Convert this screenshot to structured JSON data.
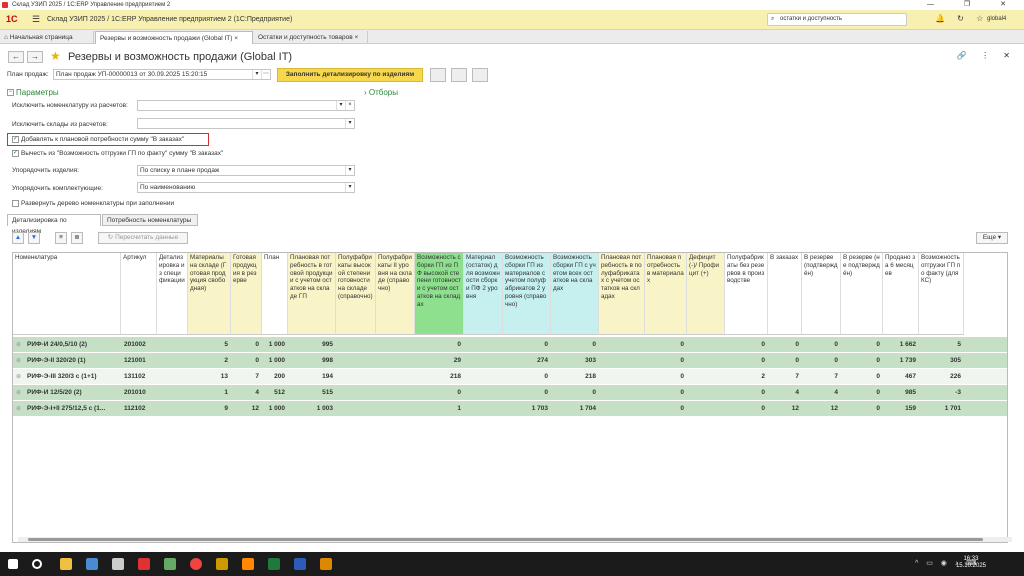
{
  "window": {
    "title": "Склад УЗИП 2025 / 1С:ERP Управление предприятием 2",
    "controls": "— ❐ ✕"
  },
  "app": {
    "logo": "1С",
    "title": "Склад УЗИП 2025 / 1С:ERP Управление предприятием 2  (1С:Предприятие)",
    "search_value": "остатки и доступность",
    "user": "global4",
    "icons": "🔔 ↻ ☆ "
  },
  "tabs": {
    "home": "Начальная страница",
    "tab1": "Резервы и возможность продажи (Global IT)",
    "tab2": "Остатки и доступность товаров",
    "close": "×"
  },
  "form": {
    "title": "Резервы и возможность продажи (Global IT)",
    "back": "←",
    "fwd": "→",
    "star": "★",
    "icons": "🔗 ⋮ ✕"
  },
  "plan": {
    "label": "План продаж:",
    "value": "План продаж УП-00000013 от 30.09.2025 15:20:15",
    "fill_btn": "Заполнить детализировку по изделиям"
  },
  "params": {
    "title": "Параметры",
    "filters": "Отборы",
    "excl_nom_label": "Исключить номенклатуру из расчетов:",
    "excl_wh_label": "Исключить склады из расчетов:",
    "cb1": "Добавлять к плановой потребности сумму \"В заказах\"",
    "cb2": "Вычесть из \"Возможность отгрузки ГП по факту\" сумму \"В заказах\"",
    "order_items_label": "Упорядочить изделия:",
    "order_items_value": "По списку в плане продаж",
    "order_kit_label": "Упорядочить комплектующие:",
    "order_kit_value": "По наименованию",
    "expand_label": "Развернуть дерево номенклатуры при заполнении"
  },
  "subtabs": {
    "t1": "Детализировка по изделиям",
    "t2": "Потребность номенклатуры"
  },
  "toolbar": {
    "recalc": "Пересчитать данные",
    "more": "Еще ▾"
  },
  "columns": [
    "Номенклатура",
    "Артикул",
    "Детализировка из спецификации",
    "Материалы на складе (Готовая продукция свободная)",
    "Готовая продукция в резерве",
    "План",
    "Плановая потребность в готовой продукции с учетом остатков на складе ГП",
    "Полуфабрикаты высокой степени готовности на складе (справочно)",
    "Полуфабрикаты II уровня на складе (справочно)",
    "Возможность сборки ГП из ПФ высокой степени готовности с учетом остатков на складах",
    "Материал (остаток) для возможности сборки ПФ 2 уровня",
    "Возможность сборки ГП из материалов с учетом полуфабрикатов 2 уровня (справочно)",
    "Возможность сборки ГП с учетом всех остатков на складах",
    "Плановая потребность в полуфабрикатах с учетом остатков на складах",
    "Плановая потребность в материалах",
    "Дефицит (-)/ Профицит (+)",
    "Полуфабрикаты без резервов в производстве",
    "В заказах",
    "В резерве (подтверждён)",
    "В резерве (не подтверждён)",
    "Продано за 6 месяцев",
    "Возможность отгрузки ГП по факту (для КС)"
  ],
  "rows": [
    {
      "name": "РИФ-И 24/0,5/10 (2)",
      "art": "201002",
      "d": "",
      "m": "5",
      "g": "0",
      "plan": "1 000",
      "pp": "995",
      "pf": "",
      "pf2": "",
      "vs": "0",
      "mat": "",
      "vs2": "0",
      "vsa": "0",
      "ppf": "",
      "ppm": "0",
      "def": "",
      "pfb": "0",
      "vz": "0",
      "vr": "0",
      "vrn": "0",
      "sold": "1 662",
      "vo": "5"
    },
    {
      "name": "РИФ-Э-II 320/20 (1)",
      "art": "121001",
      "d": "",
      "m": "2",
      "g": "0",
      "plan": "1 000",
      "pp": "998",
      "pf": "",
      "pf2": "",
      "vs": "29",
      "mat": "",
      "vs2": "274",
      "vsa": "303",
      "ppf": "",
      "ppm": "0",
      "def": "",
      "pfb": "0",
      "vz": "0",
      "vr": "0",
      "vrn": "0",
      "sold": "1 739",
      "vo": "305"
    },
    {
      "name": "РИФ-Э-III 320/3 с (1+1)",
      "art": "131102",
      "d": "",
      "m": "13",
      "g": "7",
      "plan": "200",
      "pp": "194",
      "pf": "",
      "pf2": "",
      "vs": "218",
      "mat": "",
      "vs2": "0",
      "vsa": "218",
      "ppf": "",
      "ppm": "0",
      "def": "",
      "pfb": "2",
      "vz": "7",
      "vr": "7",
      "vrn": "0",
      "sold": "467",
      "vo": "226"
    },
    {
      "name": "РИФ-И 12/5/20 (2)",
      "art": "201010",
      "d": "",
      "m": "1",
      "g": "4",
      "plan": "512",
      "pp": "515",
      "pf": "",
      "pf2": "",
      "vs": "0",
      "mat": "",
      "vs2": "0",
      "vsa": "0",
      "ppf": "",
      "ppm": "0",
      "def": "",
      "pfb": "0",
      "vz": "4",
      "vr": "4",
      "vrn": "0",
      "sold": "985",
      "vo": "-3"
    },
    {
      "name": "РИФ-Э-I+II 275/12,5 с (1...",
      "art": "112102",
      "d": "",
      "m": "9",
      "g": "12",
      "plan": "1 000",
      "pp": "1 003",
      "pf": "",
      "pf2": "",
      "vs": "1",
      "mat": "",
      "vs2": "1 703",
      "vsa": "1 704",
      "ppf": "",
      "ppm": "0",
      "def": "",
      "pfb": "0",
      "vz": "12",
      "vr": "12",
      "vrn": "0",
      "sold": "159",
      "vo": "1 701"
    }
  ],
  "taskbar": {
    "time": "16:33",
    "date": "15.10.2025"
  },
  "colors": {
    "yellow_header": "#f8f0b0",
    "green_col": "#8ee08e",
    "cyan_col": "#c6f0f0",
    "light_yellow": "#f8f4c8",
    "row_green": "#c5e0c5",
    "accent": "#2a8a3a"
  }
}
